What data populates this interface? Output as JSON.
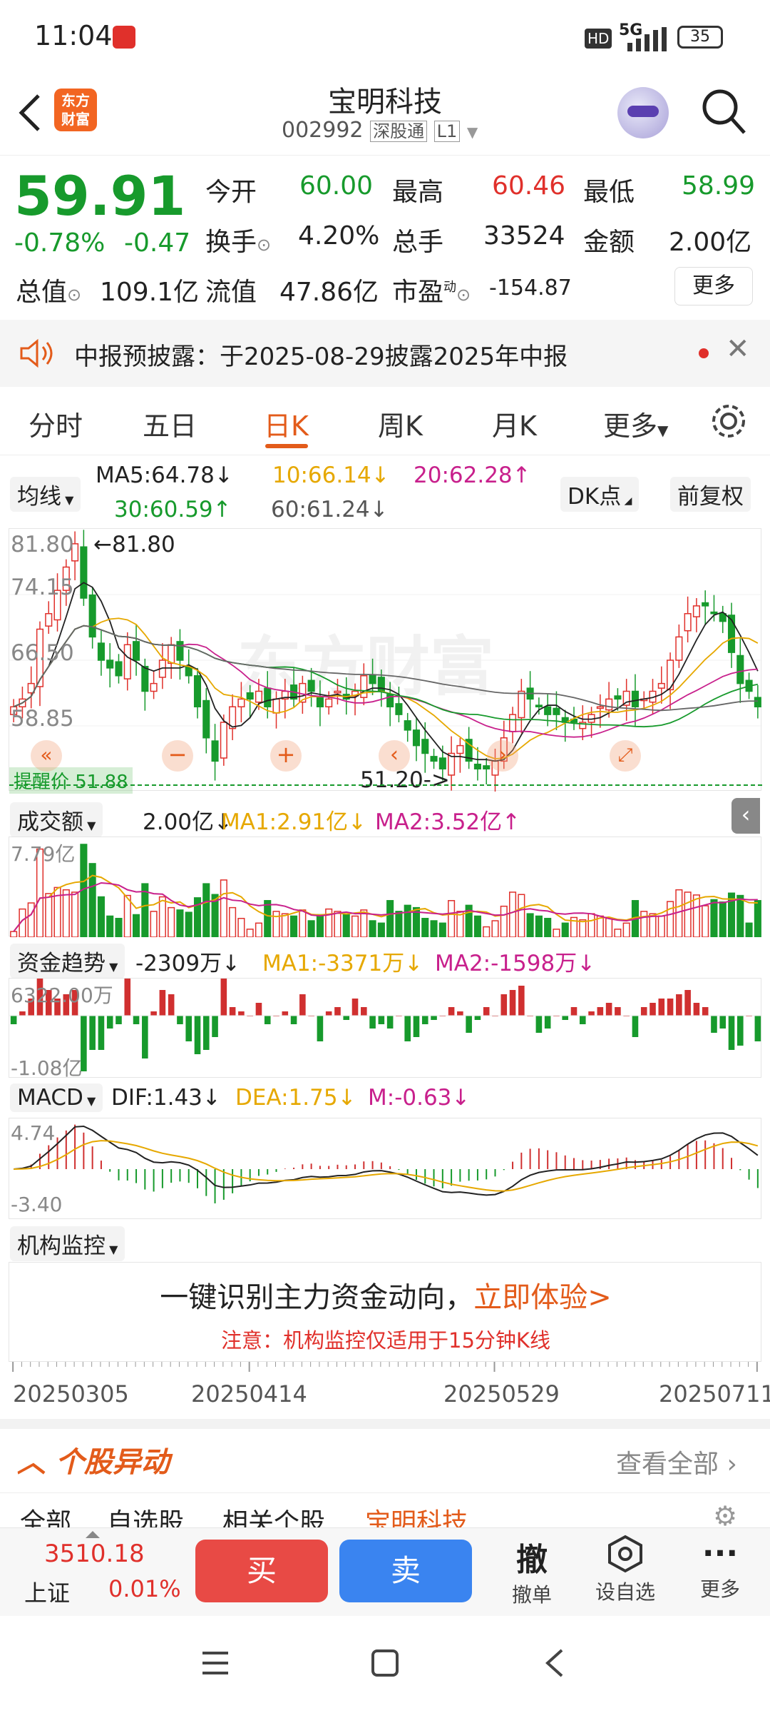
{
  "status": {
    "time": "11:04",
    "network": "5G",
    "battery": "35"
  },
  "header": {
    "title": "宝明科技",
    "code": "002992",
    "market": "深股通",
    "level": "L1",
    "logo_top": "东方",
    "logo_bottom": "财富"
  },
  "quote": {
    "price": "59.91",
    "change_pct": "-0.78%",
    "change": "-0.47",
    "open_label": "今开",
    "open": "60.00",
    "high_label": "最高",
    "high": "60.46",
    "low_label": "最低",
    "low": "58.99",
    "turnover_label": "换手",
    "turnover": "4.20%",
    "volume_label": "总手",
    "volume": "33524",
    "amount_label": "金额",
    "amount": "2.00亿",
    "mktcap_label": "总值",
    "mktcap": "109.1亿",
    "float_label": "流值",
    "float": "47.86亿",
    "pe_label": "市盈",
    "pe_sup": "动",
    "pe": "-154.87",
    "more": "更多"
  },
  "notice": {
    "text": "中报预披露：于2025-08-29披露2025年中报"
  },
  "tabs": [
    "分时",
    "五日",
    "日K",
    "周K",
    "月K",
    "更多"
  ],
  "ma": {
    "selector": "均线",
    "ma5": "MA5:64.78↓",
    "ma10": "10:66.14↓",
    "ma20": "20:62.28↑",
    "ma30": "30:60.59↑",
    "ma60": "60:61.24↓",
    "dk": "DK点",
    "fq": "前复权"
  },
  "kline": {
    "y_labels": [
      "81.80",
      "74.15",
      "66.50",
      "58.85"
    ],
    "max_mark": "←81.80",
    "min_mark": "51.20->",
    "alert": "提醒价 51.88",
    "watermark": "东方财富"
  },
  "vol": {
    "selector": "成交额",
    "value": "2.00亿↓",
    "ma1": "MA1:2.91亿↓",
    "ma2": "MA2:3.52亿↑",
    "top": "7.79亿"
  },
  "fund": {
    "selector": "资金趋势",
    "value": "-2309万↓",
    "ma1": "MA1:-3371万↓",
    "ma2": "MA2:-1598万↓",
    "top": "6322.00万",
    "bottom": "-1.08亿"
  },
  "macd": {
    "selector": "MACD",
    "dif": "DIF:1.43↓",
    "dea": "DEA:1.75↓",
    "m": "M:-0.63↓",
    "top": "4.74",
    "bottom": "-3.40"
  },
  "inst": {
    "selector": "机构监控",
    "line1": "一键识别主力资金动向，",
    "link": "立即体验>",
    "note": "注意：机构监控仅适用于15分钟K线"
  },
  "dates": [
    "20250305",
    "20250414",
    "20250529",
    "20250711"
  ],
  "movers": {
    "title": "个股异动",
    "view_all": "查看全部",
    "tabs": [
      "全部",
      "自选股",
      "相关个股",
      "宝明科技"
    ]
  },
  "bottom": {
    "index_value": "3510.18",
    "index_name": "上证",
    "index_pct": "0.01%",
    "buy": "买",
    "sell": "卖",
    "cancel_icon": "撤",
    "cancel": "撤单",
    "watch": "设自选",
    "more": "更多"
  },
  "chart_data": {
    "type": "candlestick",
    "x_range": [
      "20250305",
      "20250711"
    ],
    "y_labels": [
      81.8,
      74.15,
      66.5,
      58.85
    ],
    "approx_close": [
      60,
      61,
      63,
      70,
      72,
      75,
      78,
      81,
      74,
      69,
      66,
      65,
      64,
      68,
      66,
      62,
      63,
      66,
      68,
      66,
      64,
      60,
      56,
      53,
      58,
      60,
      61,
      61,
      62,
      60,
      61,
      62,
      61,
      63,
      62,
      60,
      61,
      62,
      61,
      62,
      64,
      63,
      62,
      60,
      59,
      57,
      55,
      54,
      53,
      52,
      54,
      55,
      53,
      52,
      52,
      53,
      56,
      59,
      62,
      61,
      60,
      59,
      59,
      58,
      58,
      58,
      59,
      60,
      61,
      61,
      62,
      60,
      61,
      62,
      63,
      66,
      69,
      72,
      73,
      73,
      72,
      71,
      67,
      63,
      62,
      60
    ]
  }
}
